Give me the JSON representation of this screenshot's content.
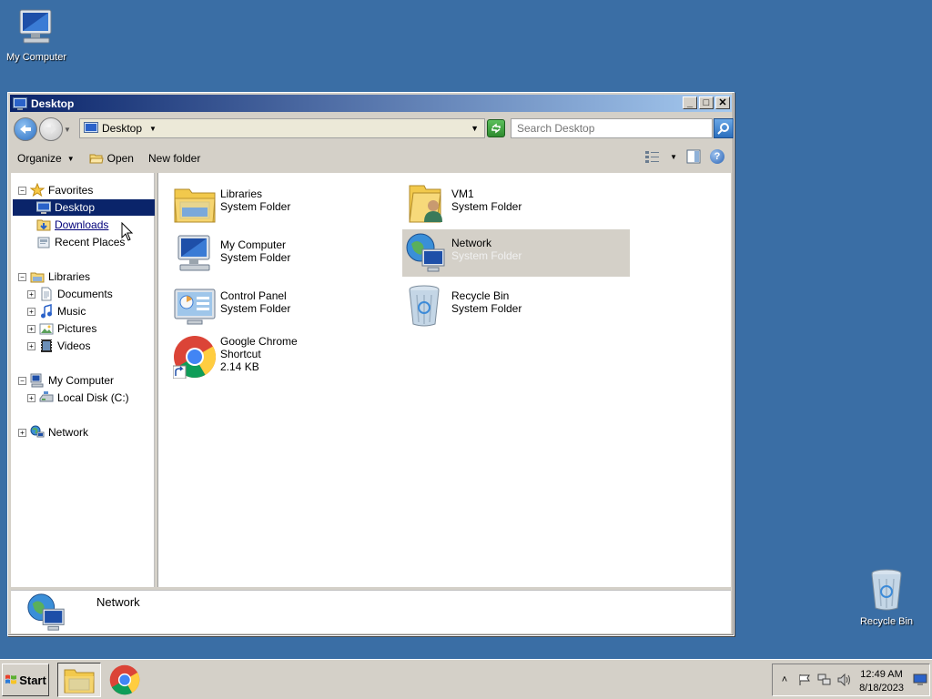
{
  "desktop": {
    "icons": [
      {
        "label": "My Computer"
      },
      {
        "label": "Recycle Bin"
      }
    ]
  },
  "window": {
    "title": "Desktop",
    "buttons": {
      "minimize": "_",
      "maximize": "□",
      "close": "✕"
    },
    "address": {
      "location": "Desktop"
    },
    "search": {
      "placeholder": "Search Desktop"
    },
    "toolbar": {
      "organize": "Organize",
      "open": "Open",
      "new_folder": "New folder"
    },
    "nav_pane": {
      "favorites": "Favorites",
      "desktop": "Desktop",
      "downloads": "Downloads",
      "recent_places": "Recent Places",
      "libraries": "Libraries",
      "documents": "Documents",
      "music": "Music",
      "pictures": "Pictures",
      "videos": "Videos",
      "my_computer": "My Computer",
      "local_disk": "Local Disk (C:)",
      "network": "Network"
    },
    "items": [
      {
        "name": "Libraries",
        "type": "System Folder"
      },
      {
        "name": "VM1",
        "type": "System Folder"
      },
      {
        "name": "My Computer",
        "type": "System Folder"
      },
      {
        "name": "Network",
        "type": "System Folder"
      },
      {
        "name": "Control Panel",
        "type": "System Folder"
      },
      {
        "name": "Recycle Bin",
        "type": "System Folder"
      },
      {
        "name": "Google Chrome",
        "type": "Shortcut",
        "size": "2.14 KB"
      }
    ],
    "details": {
      "name": "Network"
    }
  },
  "taskbar": {
    "start": "Start",
    "clock": {
      "time": "12:49 AM",
      "date": "8/18/2023"
    }
  },
  "colors": {
    "desktop": "#3a6ea5",
    "title_gradient_start": "#0a246a",
    "title_gradient_end": "#a6caf0",
    "selection": "#0a246a"
  }
}
